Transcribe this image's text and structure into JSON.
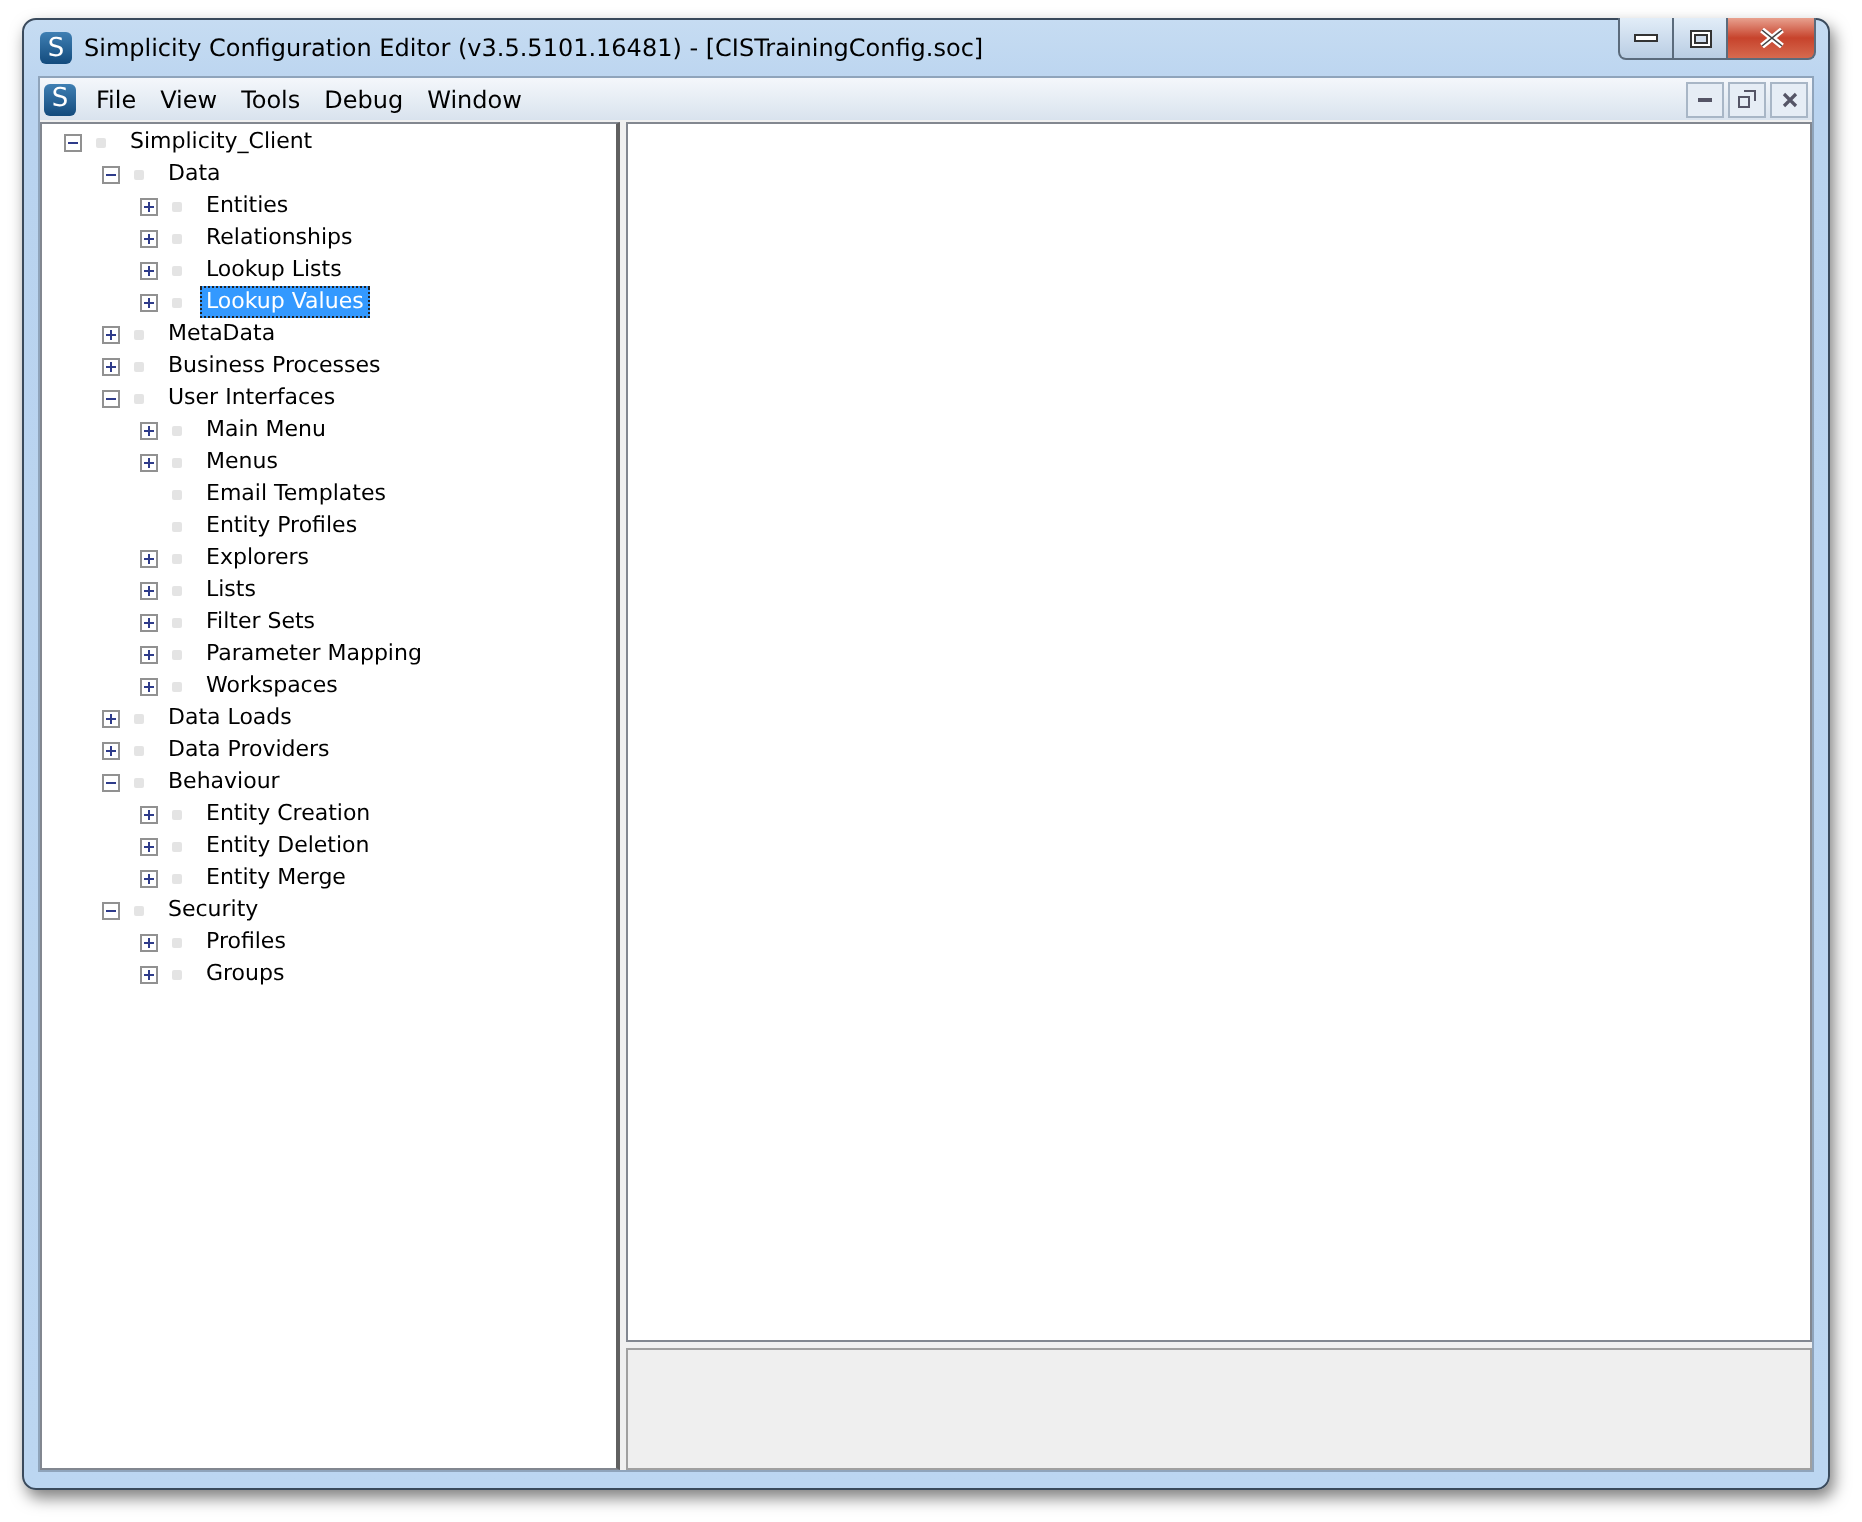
{
  "window": {
    "title": "Simplicity Configuration Editor (v3.5.5101.16481) - [CISTrainingConfig.soc]",
    "app_letter": "S"
  },
  "menu_bar": {
    "app_letter": "S",
    "items": [
      "File",
      "View",
      "Tools",
      "Debug",
      "Window"
    ]
  },
  "tree": [
    {
      "label": "Simplicity_Client",
      "kind": "branch",
      "expanded": true,
      "selected": false,
      "children": [
        {
          "label": "Data",
          "kind": "branch",
          "expanded": true,
          "selected": false,
          "children": [
            {
              "label": "Entities",
              "kind": "branch",
              "expanded": false,
              "selected": false
            },
            {
              "label": "Relationships",
              "kind": "branch",
              "expanded": false,
              "selected": false
            },
            {
              "label": "Lookup Lists",
              "kind": "branch",
              "expanded": false,
              "selected": false
            },
            {
              "label": "Lookup Values",
              "kind": "branch",
              "expanded": false,
              "selected": true
            }
          ]
        },
        {
          "label": "MetaData",
          "kind": "branch",
          "expanded": false,
          "selected": false
        },
        {
          "label": "Business Processes",
          "kind": "branch",
          "expanded": false,
          "selected": false
        },
        {
          "label": "User Interfaces",
          "kind": "branch",
          "expanded": true,
          "selected": false,
          "children": [
            {
              "label": "Main Menu",
              "kind": "branch",
              "expanded": false,
              "selected": false
            },
            {
              "label": "Menus",
              "kind": "branch",
              "expanded": false,
              "selected": false
            },
            {
              "label": "Email Templates",
              "kind": "leaf",
              "selected": false
            },
            {
              "label": "Entity Profiles",
              "kind": "leaf",
              "selected": false
            },
            {
              "label": "Explorers",
              "kind": "branch",
              "expanded": false,
              "selected": false
            },
            {
              "label": "Lists",
              "kind": "branch",
              "expanded": false,
              "selected": false
            },
            {
              "label": "Filter Sets",
              "kind": "branch",
              "expanded": false,
              "selected": false
            },
            {
              "label": "Parameter Mapping",
              "kind": "branch",
              "expanded": false,
              "selected": false
            },
            {
              "label": "Workspaces",
              "kind": "branch",
              "expanded": false,
              "selected": false
            }
          ]
        },
        {
          "label": "Data Loads",
          "kind": "branch",
          "expanded": false,
          "selected": false
        },
        {
          "label": "Data Providers",
          "kind": "branch",
          "expanded": false,
          "selected": false
        },
        {
          "label": "Behaviour",
          "kind": "branch",
          "expanded": true,
          "selected": false,
          "children": [
            {
              "label": "Entity Creation",
              "kind": "branch",
              "expanded": false,
              "selected": false
            },
            {
              "label": "Entity Deletion",
              "kind": "branch",
              "expanded": false,
              "selected": false
            },
            {
              "label": "Entity Merge",
              "kind": "branch",
              "expanded": false,
              "selected": false
            }
          ]
        },
        {
          "label": "Security",
          "kind": "branch",
          "expanded": true,
          "selected": false,
          "children": [
            {
              "label": "Profiles",
              "kind": "branch",
              "expanded": false,
              "selected": false
            },
            {
              "label": "Groups",
              "kind": "branch",
              "expanded": false,
              "selected": false
            }
          ]
        }
      ]
    }
  ]
}
